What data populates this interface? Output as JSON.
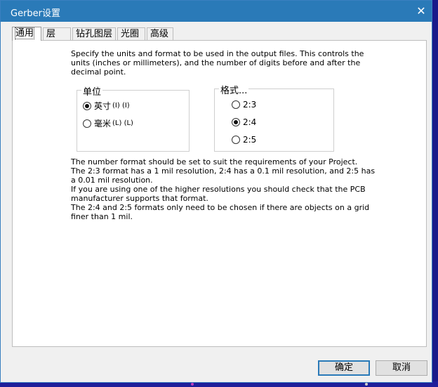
{
  "window": {
    "title": "Gerber设置",
    "close_glyph": "✕"
  },
  "tabs": [
    {
      "label": "通用",
      "active": true
    },
    {
      "label": "层",
      "active": false
    },
    {
      "label": "钻孔图层",
      "active": false
    },
    {
      "label": "光圈",
      "active": false
    },
    {
      "label": "高级",
      "active": false
    }
  ],
  "general": {
    "description": "Specify the units and format to be used in the output files. This controls the units (inches or millimeters), and the number of digits before and after the decimal point.",
    "units": {
      "legend": "单位",
      "options": [
        {
          "label": "英寸",
          "accel": "(I) (I)",
          "checked": true
        },
        {
          "label": "毫米",
          "accel": "(L) (L)",
          "checked": false
        }
      ]
    },
    "format": {
      "legend": "格式...",
      "options": [
        {
          "label": "2:3",
          "checked": false
        },
        {
          "label": "2:4",
          "checked": true
        },
        {
          "label": "2:5",
          "checked": false
        }
      ]
    },
    "info_lines": [
      "The number format should be set to suit the requirements of your Project.",
      "The 2:3 format has a 1 mil resolution, 2:4 has a 0.1 mil resolution, and 2:5 has a 0.01 mil resolution.",
      "If you are using one of the higher resolutions you should check that the PCB manufacturer supports that format.",
      "The 2:4 and 2:5 formats only need to be chosen if there are objects on a grid finer than 1 mil."
    ]
  },
  "buttons": {
    "ok": "确定",
    "cancel": "取消"
  }
}
